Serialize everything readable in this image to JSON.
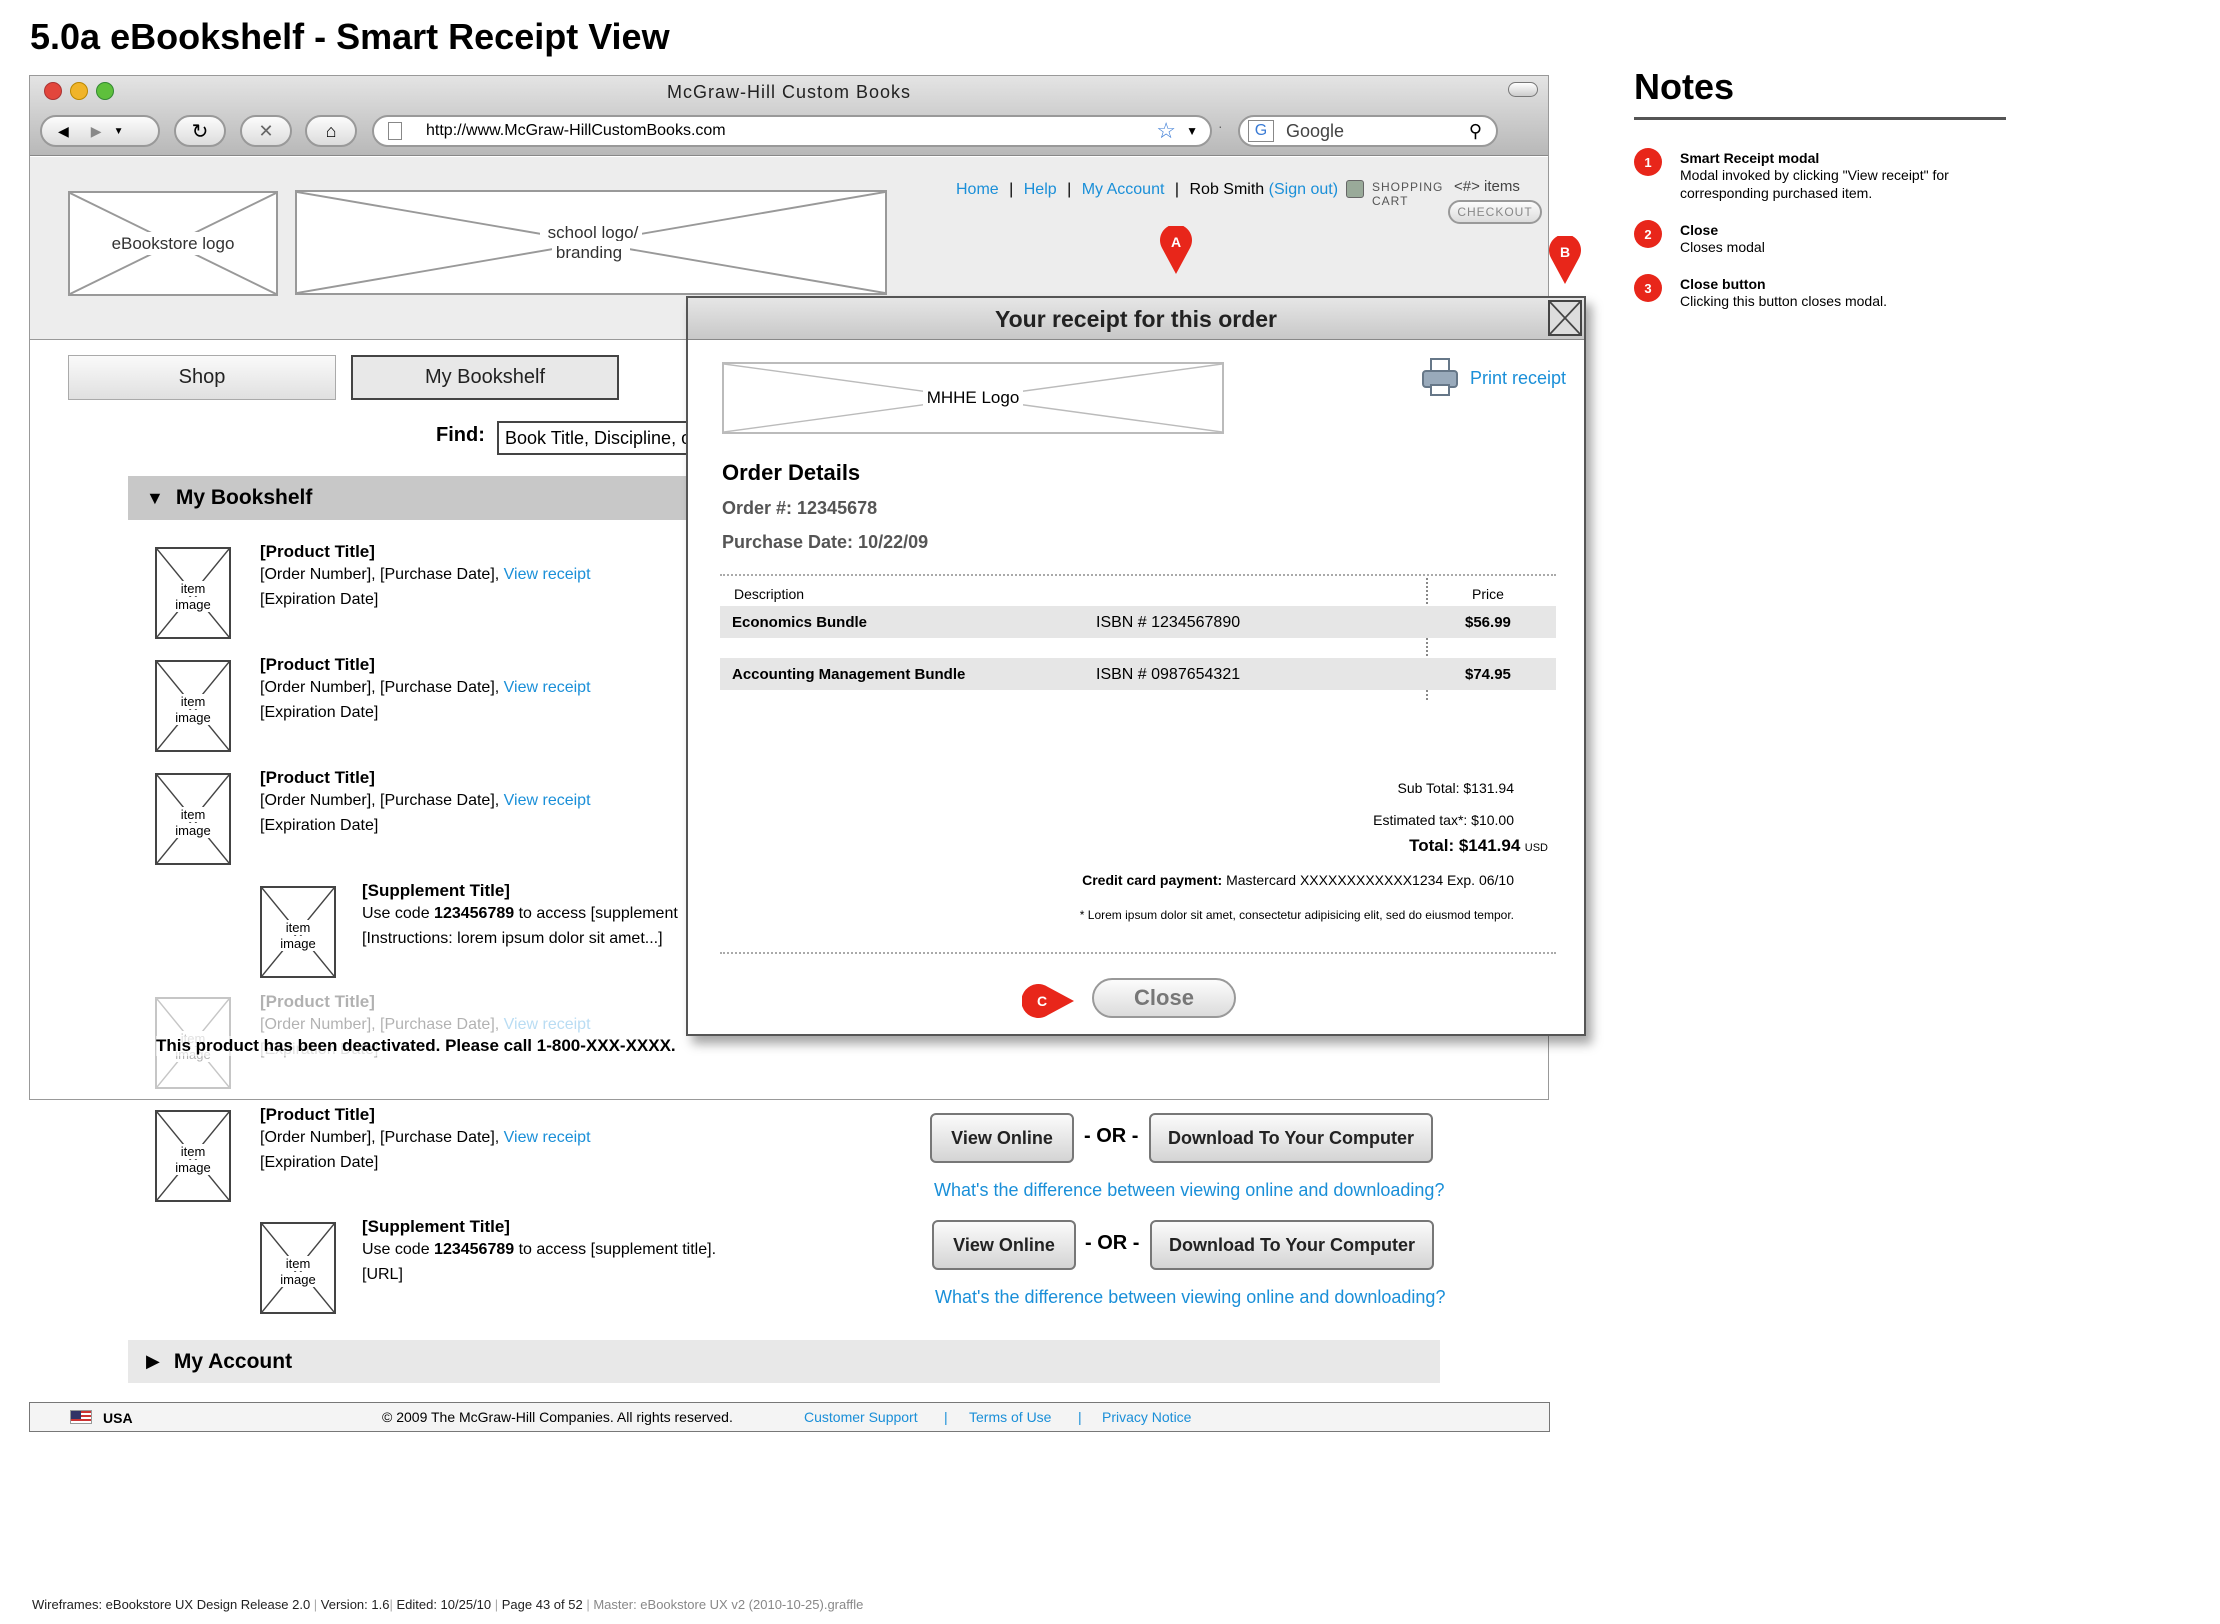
{
  "page_title": "5.0a eBookshelf - Smart Receipt View",
  "browser": {
    "window_title": "McGraw-Hill Custom Books",
    "url": "http://www.McGraw-HillCustomBooks.com",
    "search_placeholder": "Google"
  },
  "header": {
    "ebookstore_logo": "eBookstore logo",
    "school_logo_line1": "school logo/",
    "school_logo_line2": "branding",
    "nav_home": "Home",
    "nav_help": "Help",
    "nav_account": "My Account",
    "nav_user": "Rob Smith",
    "nav_signout": "Sign out",
    "cart_line1": "SHOPPING",
    "cart_line2": "CART",
    "cart_items": "<#> items",
    "checkout": "CHECKOUT"
  },
  "tabs": {
    "shop": "Shop",
    "bookshelf": "My Bookshelf"
  },
  "find": {
    "label": "Find:",
    "placeholder": "Book Title, Discipline, or"
  },
  "bookshelf": {
    "heading": "My Bookshelf",
    "item_image": [
      "item",
      "image"
    ],
    "product_title": "[Product Title]",
    "order_line": "[Order Number], [Purchase Date],",
    "view_receipt": "View receipt",
    "expiration": "[Expiration Date]",
    "supplement_title": "[Supplement Title]",
    "supp_use": "Use code",
    "supp_code": "123456789",
    "supp_access_clipped": "to access [supplement",
    "supp_access": "to access [supplement title].",
    "supp_instructions": "[Instructions: lorem ipsum dolor sit amet...]",
    "supp_url": "[URL]",
    "deactivated": "This product has been deactivated. Please call 1-800-XXX-XXXX.",
    "view_online": "View Online",
    "or": "- OR -",
    "download": "Download To Your Computer",
    "difference": "What's the difference between viewing online and downloading?"
  },
  "account": {
    "heading": "My Account"
  },
  "footer": {
    "country": "USA",
    "copyright": "© 2009  The McGraw-Hill Companies.  All rights reserved.",
    "support": "Customer Support",
    "terms": "Terms of Use",
    "privacy": "Privacy Notice",
    "sep": "|"
  },
  "modal": {
    "title": "Your receipt for this order",
    "logo": "MHHE Logo",
    "print": "Print receipt",
    "order_details": "Order Details",
    "order_no": "Order #: 12345678",
    "purchase_date": "Purchase Date: 10/22/09",
    "col_description": "Description",
    "col_price": "Price",
    "rows": [
      {
        "name": "Economics Bundle",
        "isbn": "ISBN # 1234567890",
        "price": "$56.99"
      },
      {
        "name": "Accounting Management Bundle",
        "isbn": "ISBN # 0987654321",
        "price": "$74.95"
      }
    ],
    "subtotal": "Sub Total: $131.94",
    "tax": "Estimated tax*: $10.00",
    "total": "Total: $141.94",
    "currency": "USD",
    "cc_label": "Credit card payment:",
    "cc_value": "Mastercard XXXXXXXXXXXX1234 Exp. 06/10",
    "footnote": "* Lorem ipsum dolor sit amet, consectetur adipisicing elit, sed do eiusmod tempor.",
    "close": "Close"
  },
  "callouts": {
    "a": "A",
    "b": "B",
    "c": "C"
  },
  "notes": {
    "heading": "Notes",
    "items": [
      {
        "num": "1",
        "title": "Smart Receipt modal",
        "desc1": "Modal invoked by clicking \"View receipt\" for",
        "desc2": "corresponding purchased item."
      },
      {
        "num": "2",
        "title": "Close",
        "desc1": "Closes modal",
        "desc2": ""
      },
      {
        "num": "3",
        "title": "Close button",
        "desc1": "Clicking this button closes modal.",
        "desc2": ""
      }
    ]
  },
  "doc_footer": {
    "wire": "Wireframes: eBookstore UX Design Release 2.0",
    "version": "Version: 1.6",
    "edited": "Edited:  10/25/10",
    "page": "Page 43 of 52",
    "master": "Master: eBookstore UX v2 (2010-10-25).graffle"
  }
}
